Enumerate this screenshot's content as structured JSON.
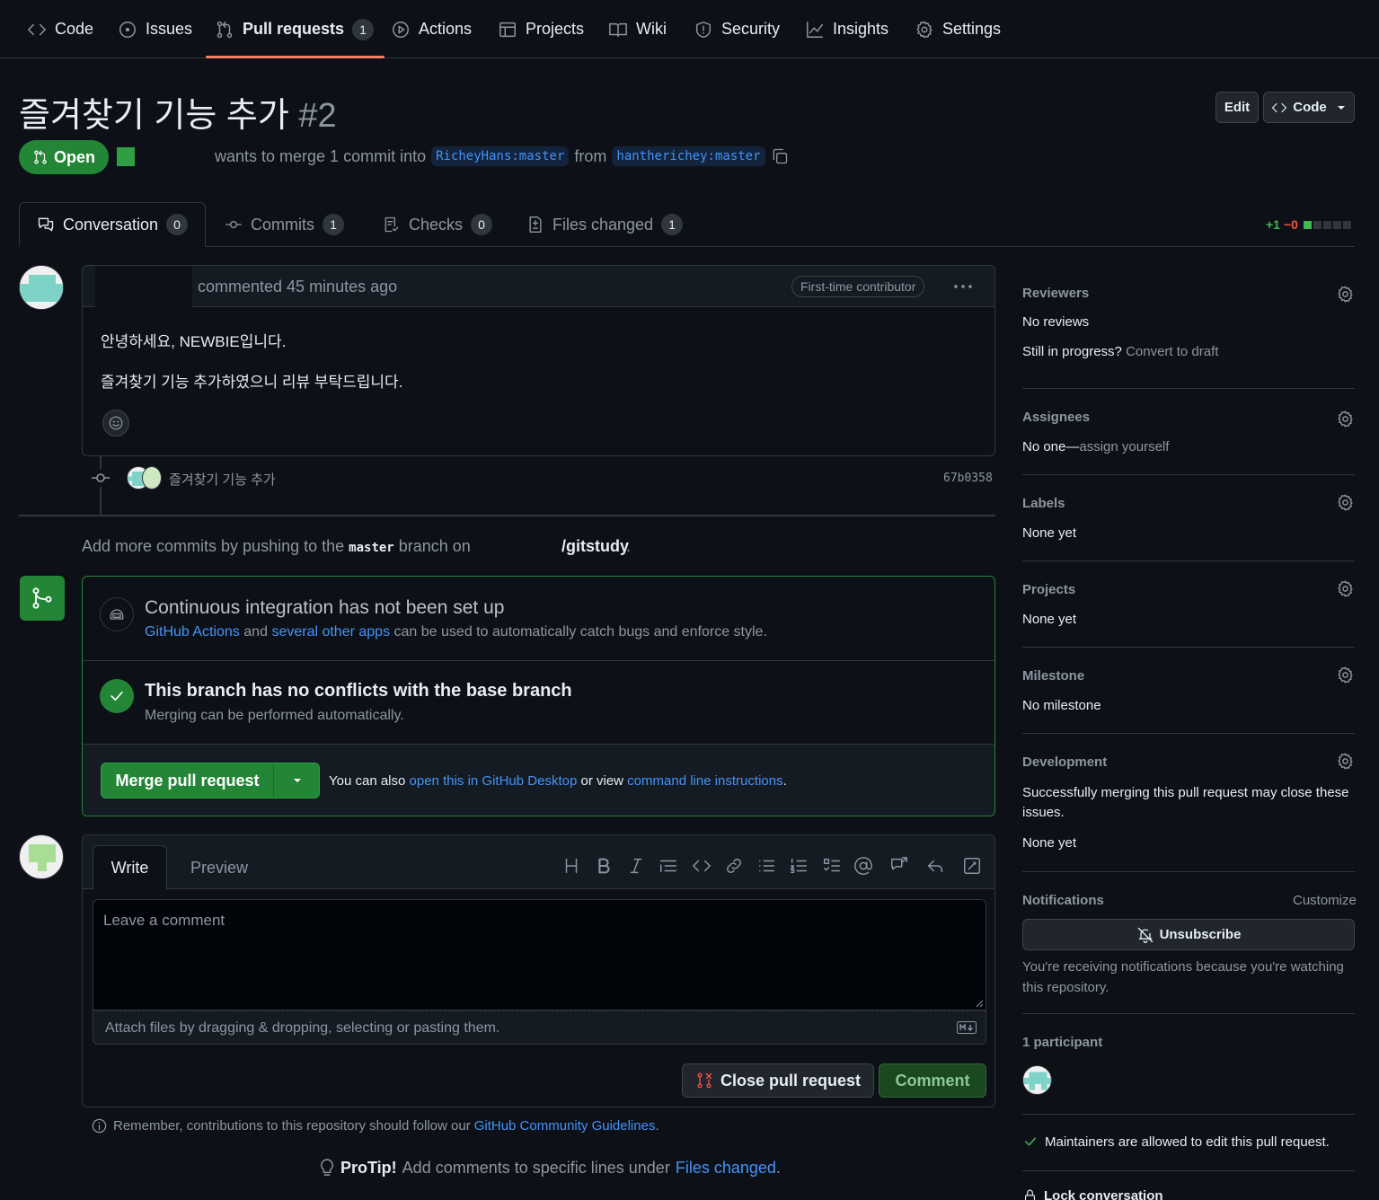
{
  "nav": {
    "code": "Code",
    "issues": "Issues",
    "pull_requests": "Pull requests",
    "pull_requests_count": "1",
    "actions": "Actions",
    "projects": "Projects",
    "wiki": "Wiki",
    "security": "Security",
    "insights": "Insights",
    "settings": "Settings"
  },
  "header": {
    "title": "즐겨찾기 기능 추가",
    "number": "#2",
    "edit_label": "Edit",
    "code_label": "Code",
    "status": "Open",
    "merge_text": "wants to merge 1 commit into",
    "base_branch": "RicheyHans:master",
    "from_text": "from",
    "head_branch": "hantherichey:master"
  },
  "tabs": {
    "conversation": "Conversation",
    "conversation_count": "0",
    "commits": "Commits",
    "commits_count": "1",
    "checks": "Checks",
    "checks_count": "0",
    "files": "Files changed",
    "files_count": "1",
    "additions": "+1",
    "deletions": "−0"
  },
  "comment": {
    "meta": "commented 45 minutes ago",
    "badge": "First-time contributor",
    "line1": "안녕하세요, NEWBIE입니다.",
    "line2": "즐겨찾기 기능 추가하였으니 리뷰 부탁드립니다."
  },
  "commit": {
    "message": "즐겨찾기 기능 추가",
    "sha": "67b0358"
  },
  "push_hint": {
    "prefix": "Add more commits by pushing to the",
    "branch": "master",
    "middle": "branch on",
    "repo": "/gitstudy",
    "suffix": "."
  },
  "merge": {
    "ci_title": "Continuous integration has not been set up",
    "ci_link1": "GitHub Actions",
    "ci_and": "and",
    "ci_link2": "several other apps",
    "ci_rest": "can be used to automatically catch bugs and enforce style.",
    "conflict_title": "This branch has no conflicts with the base branch",
    "conflict_sub": "Merging can be performed automatically.",
    "merge_button": "Merge pull request",
    "also": "You can also",
    "desktop_link": "open this in GitHub Desktop",
    "or_view": "or view",
    "cli_link": "command line instructions",
    "period": "."
  },
  "editor": {
    "write_tab": "Write",
    "preview_tab": "Preview",
    "placeholder": "Leave a comment",
    "attach": "Attach files by dragging & dropping, selecting or pasting them.",
    "close_button": "Close pull request",
    "comment_button": "Comment",
    "remember": "Remember, contributions to this repository should follow our",
    "guidelines_link": "GitHub Community Guidelines",
    "remember_end": ".",
    "protip_label": "ProTip!",
    "protip_text": "Add comments to specific lines under",
    "protip_link": "Files changed",
    "protip_end": "."
  },
  "sidebar": {
    "reviewers": "Reviewers",
    "no_reviews": "No reviews",
    "still": "Still in progress?",
    "convert": "Convert to draft",
    "assignees": "Assignees",
    "no_one": "No one—",
    "assign_yourself": "assign yourself",
    "labels": "Labels",
    "labels_value": "None yet",
    "projects": "Projects",
    "projects_value": "None yet",
    "milestone": "Milestone",
    "milestone_value": "No milestone",
    "development": "Development",
    "development_desc": "Successfully merging this pull request may close these issues.",
    "development_value": "None yet",
    "notifications": "Notifications",
    "customize": "Customize",
    "unsubscribe": "Unsubscribe",
    "notif_reason": "You're receiving notifications because you're watching this repository.",
    "participants": "1 participant",
    "maintainers": "Maintainers are allowed to edit this pull request.",
    "lock": "Lock conversation"
  },
  "colors": {
    "accent_green": "#238636",
    "link_blue": "#4493f8",
    "nav_underline": "#f78166",
    "danger": "#f85149"
  }
}
